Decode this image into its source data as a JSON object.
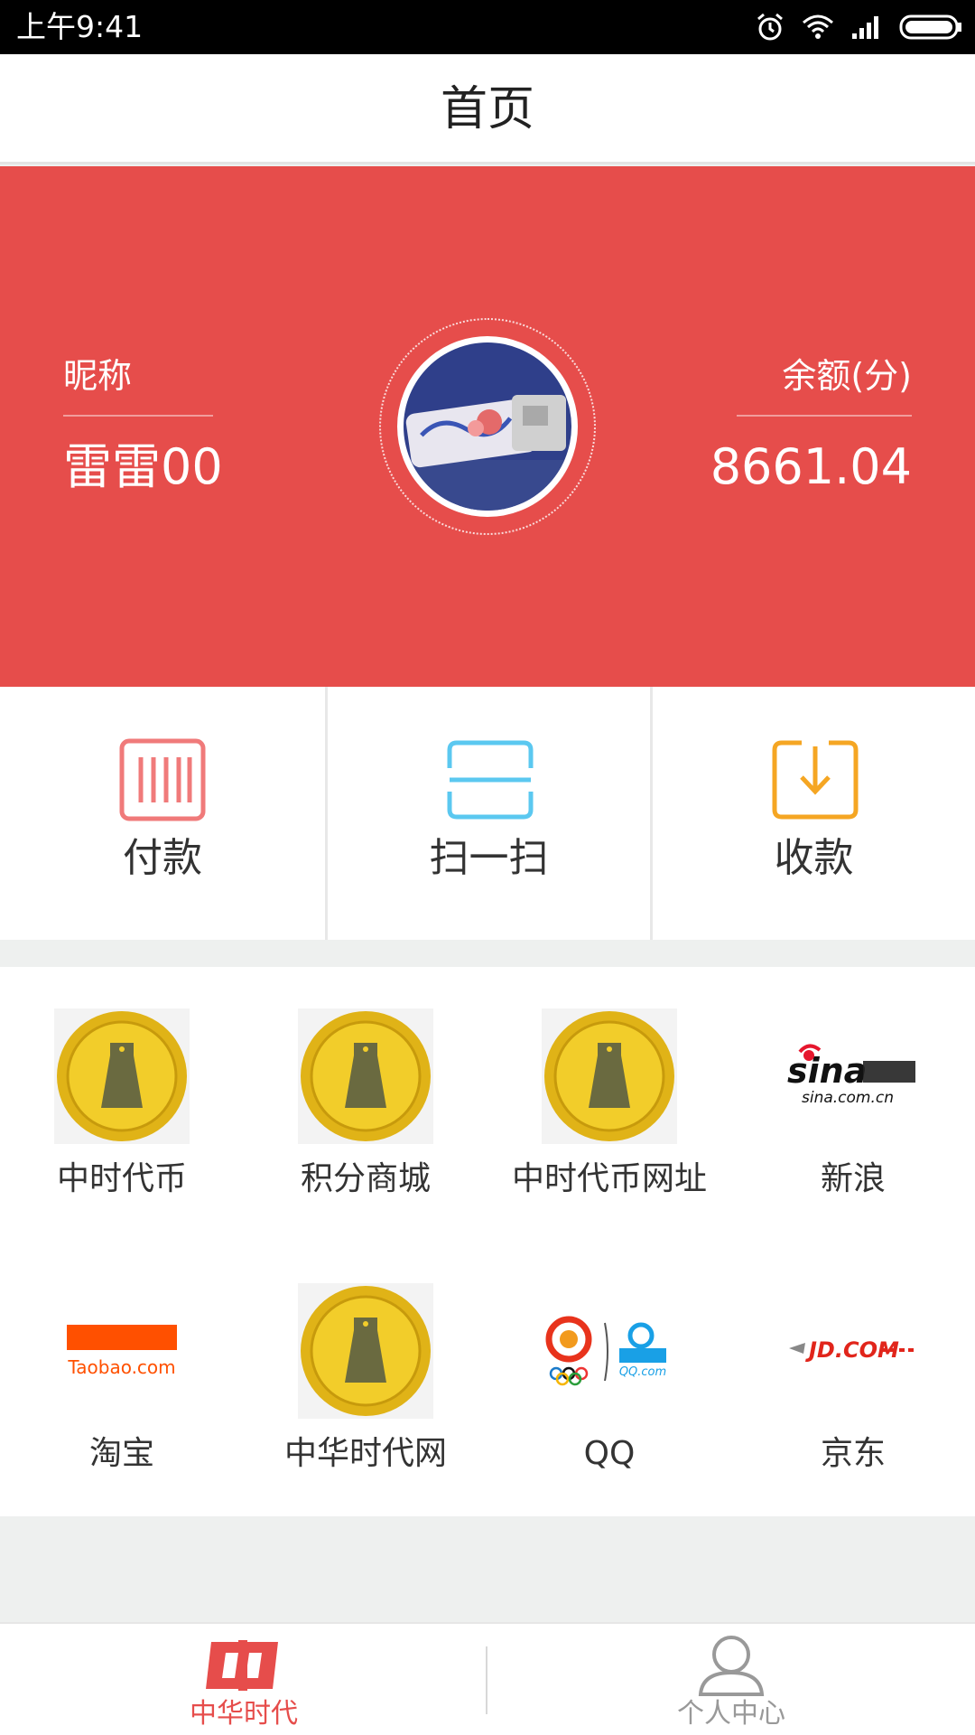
{
  "status_bar": {
    "time": "上午9:41"
  },
  "header": {
    "title": "首页"
  },
  "profile": {
    "nickname_label": "昵称",
    "nickname": "雷雷00",
    "balance_label": "余额(分)",
    "balance": "8661.04"
  },
  "actions": [
    {
      "label": "付款",
      "icon": "barcode-icon",
      "color": "#f07a7a"
    },
    {
      "label": "扫一扫",
      "icon": "scan-icon",
      "color": "#5bc8f0"
    },
    {
      "label": "收款",
      "icon": "receive-icon",
      "color": "#f5a623"
    }
  ],
  "apps": [
    {
      "label": "中时代币",
      "icon": "coin-logo"
    },
    {
      "label": "积分商城",
      "icon": "coin-logo"
    },
    {
      "label": "中时代币网址",
      "icon": "coin-logo"
    },
    {
      "label": "新浪",
      "icon": "sina-logo",
      "logo_text": "sina.com.cn"
    },
    {
      "label": "淘宝",
      "icon": "taobao-logo",
      "logo_text": "Taobao.com"
    },
    {
      "label": "中华时代网",
      "icon": "coin-logo"
    },
    {
      "label": "QQ",
      "icon": "qq-logo",
      "logo_text": "QQ.com"
    },
    {
      "label": "京东",
      "icon": "jd-logo",
      "logo_text": "JD.COM"
    }
  ],
  "tabs": [
    {
      "label": "中华时代",
      "active": true
    },
    {
      "label": "个人中心",
      "active": false
    }
  ],
  "colors": {
    "brand_red": "#e64d4b",
    "pay": "#f07a7a",
    "scan": "#5bc8f0",
    "receive": "#f5a623"
  }
}
